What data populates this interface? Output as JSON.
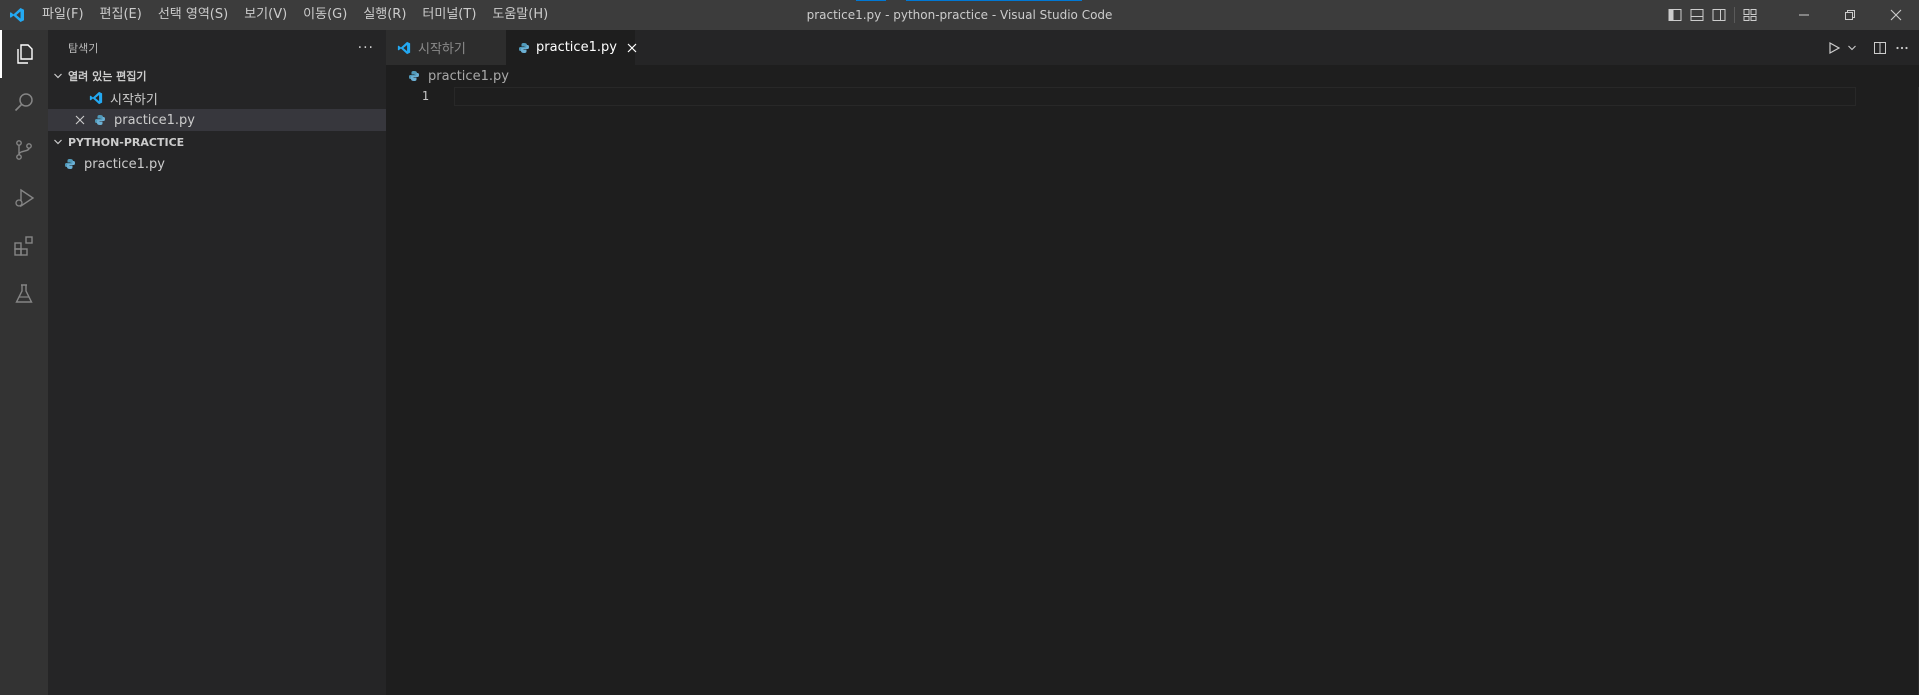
{
  "app": {
    "window_title": "practice1.py - python-practice - Visual Studio Code",
    "brand_color": "#23a9f2",
    "accent_color": "#0078d4"
  },
  "menu": [
    {
      "label": "파일(F)"
    },
    {
      "label": "편집(E)"
    },
    {
      "label": "선택 영역(S)"
    },
    {
      "label": "보기(V)"
    },
    {
      "label": "이동(G)"
    },
    {
      "label": "실행(R)"
    },
    {
      "label": "터미널(T)"
    },
    {
      "label": "도움말(H)"
    }
  ],
  "titlebar_right": {
    "layout_icons": [
      "toggle-primary-sidebar-icon",
      "toggle-panel-icon",
      "toggle-secondary-sidebar-icon",
      "customize-layout-icon"
    ],
    "window_controls": [
      "minimize-icon",
      "restore-icon",
      "close-icon"
    ]
  },
  "activitybar": {
    "items": [
      {
        "icon": "explorer-icon",
        "active": true
      },
      {
        "icon": "search-icon",
        "active": false
      },
      {
        "icon": "source-control-icon",
        "active": false
      },
      {
        "icon": "run-debug-icon",
        "active": false
      },
      {
        "icon": "extensions-icon",
        "active": false
      },
      {
        "icon": "testing-icon",
        "active": false
      }
    ]
  },
  "sidebar": {
    "title": "탐색기",
    "more_label": "···",
    "open_editors": {
      "header": "열려 있는 편집기",
      "items": [
        {
          "label": "시작하기",
          "icon": "vscode-icon"
        },
        {
          "label": "practice1.py",
          "icon": "python-file-icon",
          "selected": true
        }
      ]
    },
    "folder": {
      "header": "PYTHON-PRACTICE",
      "items": [
        {
          "label": "practice1.py",
          "icon": "python-file-icon"
        }
      ]
    }
  },
  "tabs": [
    {
      "label": "시작하기",
      "icon": "vscode-icon",
      "active": false
    },
    {
      "label": "practice1.py",
      "icon": "python-file-icon",
      "active": true
    }
  ],
  "tab_actions": [
    "run-icon",
    "chevron-down-icon",
    "split-editor-icon",
    "more-icon"
  ],
  "breadcrumb": {
    "file": "practice1.py"
  },
  "editor": {
    "lines": [
      {
        "number": "1",
        "text": ""
      }
    ]
  }
}
